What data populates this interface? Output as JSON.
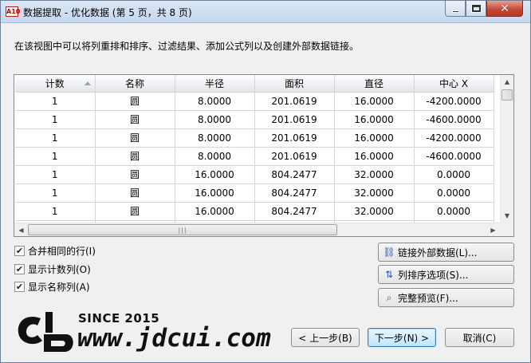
{
  "window": {
    "app_icon_text": "A10",
    "title": "数据提取 - 优化数据 (第 5 页，共 8 页)",
    "close_glyph": "✕"
  },
  "description": "在该视图中可以将列重排和排序、过滤结果、添加公式列以及创建外部数据链接。",
  "table": {
    "columns": [
      "计数",
      "名称",
      "半径",
      "面积",
      "直径",
      "中心 X"
    ],
    "rows": [
      [
        "1",
        "圆",
        "8.0000",
        "201.0619",
        "16.0000",
        "-4200.0000"
      ],
      [
        "1",
        "圆",
        "8.0000",
        "201.0619",
        "16.0000",
        "-4600.0000"
      ],
      [
        "1",
        "圆",
        "8.0000",
        "201.0619",
        "16.0000",
        "-4200.0000"
      ],
      [
        "1",
        "圆",
        "8.0000",
        "201.0619",
        "16.0000",
        "-4600.0000"
      ],
      [
        "1",
        "圆",
        "16.0000",
        "804.2477",
        "32.0000",
        "0.0000"
      ],
      [
        "1",
        "圆",
        "16.0000",
        "804.2477",
        "32.0000",
        "0.0000"
      ],
      [
        "1",
        "圆",
        "16.0000",
        "804.2477",
        "32.0000",
        "0.0000"
      ],
      [
        "",
        "",
        "",
        "",
        "",
        ""
      ]
    ]
  },
  "options": [
    {
      "label": "合并相同的行(I)",
      "checked": true
    },
    {
      "label": "显示计数列(O)",
      "checked": true
    },
    {
      "label": "显示名称列(A)",
      "checked": true
    }
  ],
  "side_buttons": [
    {
      "label": "链接外部数据(L)...",
      "icon": "link-icon"
    },
    {
      "label": "列排序选项(S)...",
      "icon": "sort-icon"
    },
    {
      "label": "完整预览(F)...",
      "icon": "preview-icon"
    }
  ],
  "buttons": {
    "prev": "< 上一步(B)",
    "next": "下一步(N) >",
    "cancel": "取消(C)"
  },
  "watermark": {
    "since": "SINCE 2015",
    "url": "www.jdcui.com"
  }
}
